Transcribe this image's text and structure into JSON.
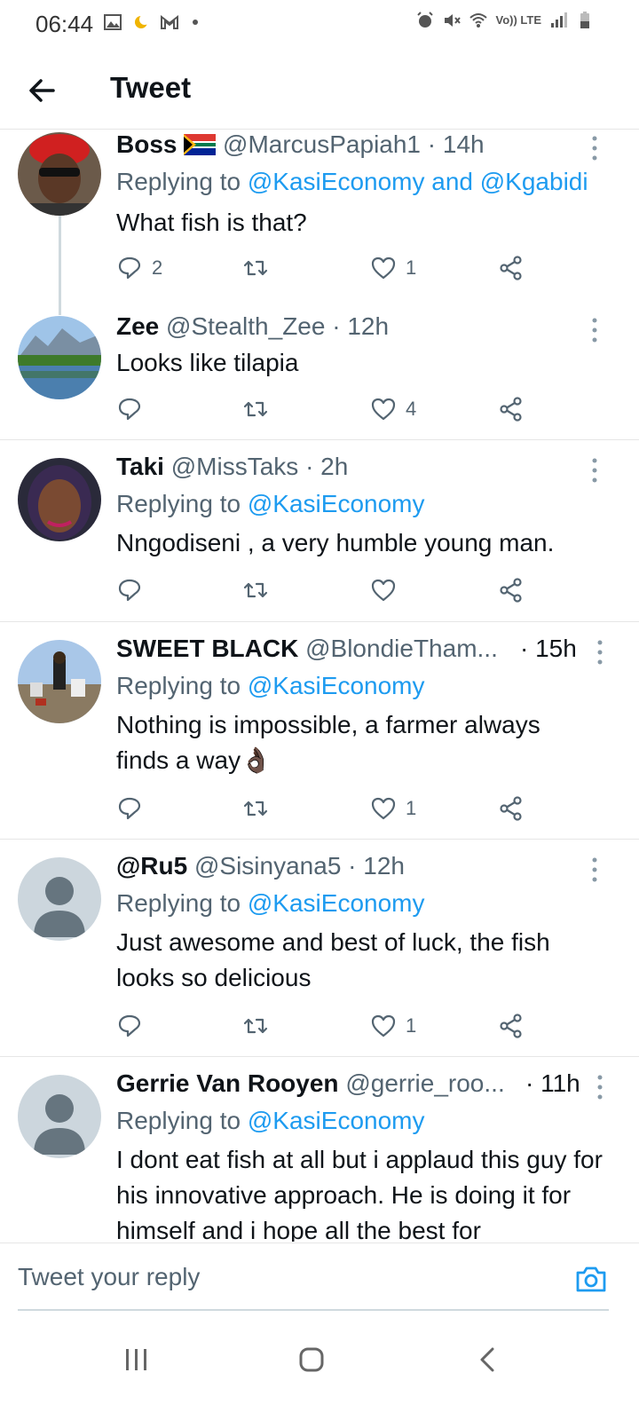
{
  "status": {
    "time": "06:44",
    "network": "Vo)) LTE"
  },
  "header": {
    "title": "Tweet"
  },
  "tweets": [
    {
      "name": "Boss",
      "handle": "@MarcusPapiah1",
      "time": "· 14h",
      "replying_prefix": "Replying to ",
      "replying_to": "@KasiEconomy and @Kgabidi",
      "text": "What fish is that?",
      "replies": "2",
      "retweets": "",
      "likes": "1"
    },
    {
      "name": "Zee",
      "handle": "@Stealth_Zee",
      "time": "· 12h",
      "text": "Looks like tilapia",
      "replies": "",
      "retweets": "",
      "likes": "4"
    },
    {
      "name": "Taki",
      "handle": "@MissTaks",
      "time": "· 2h",
      "replying_prefix": "Replying to ",
      "replying_to": "@KasiEconomy",
      "text": "Nngodiseni , a very humble young man.",
      "replies": "",
      "retweets": "",
      "likes": ""
    },
    {
      "name": "SWEET BLACK",
      "handle": "@BlondieTham...",
      "time": "· 15h",
      "replying_prefix": "Replying to ",
      "replying_to": "@KasiEconomy",
      "text": "Nothing is impossible, a farmer always finds a way👌🏿",
      "replies": "",
      "retweets": "",
      "likes": "1"
    },
    {
      "name": "@Ru5",
      "handle": "@Sisinyana5",
      "time": "· 12h",
      "replying_prefix": "Replying to ",
      "replying_to": "@KasiEconomy",
      "text": "Just awesome and best of luck, the fish looks so delicious",
      "replies": "",
      "retweets": "",
      "likes": "1"
    },
    {
      "name": "Gerrie Van Rooyen",
      "handle": "@gerrie_roo...",
      "time": "· 11h",
      "replying_prefix": "Replying to ",
      "replying_to": "@KasiEconomy",
      "text": "I dont eat fish at all but i applaud this guy for his innovative approach.  He is doing it for himself and i hope all the best for"
    }
  ],
  "reply": {
    "placeholder": "Tweet your reply"
  },
  "colors": {
    "link": "#1d9bf0",
    "secondary": "#536471",
    "border": "#e6e6e6"
  }
}
